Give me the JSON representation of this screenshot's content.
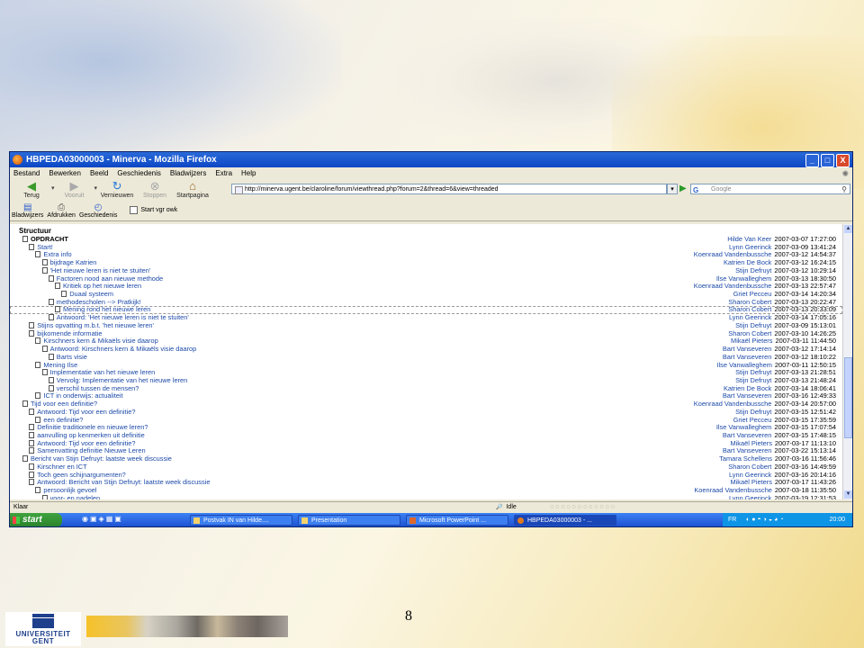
{
  "window": {
    "title": "HBPEDA03000003 - Minerva - Mozilla Firefox",
    "buttons": [
      "_",
      "□",
      "X"
    ]
  },
  "menu": [
    "Bestand",
    "Bewerken",
    "Beeld",
    "Geschiedenis",
    "Bladwijzers",
    "Extra",
    "Help"
  ],
  "nav": {
    "back": "Terug",
    "forward": "Vooruit",
    "reload": "Vernieuwen",
    "stop": "Stoppen",
    "home": "Startpagina",
    "url": "http://minerva.ugent.be/claroline/forum/viewthread.php?forum=2&thread=6&view=threaded",
    "search_placeholder": "Google"
  },
  "bookmarks": {
    "bladwijzers": "Bladwijzers",
    "afdrukken": "Afdrukken",
    "geschiedenis": "Geschiedenis",
    "autoscan": "Start vgr owk"
  },
  "structure_label": "Structuur",
  "threads": [
    {
      "title": "OPDRACHT",
      "author": "Hilde Van Keer",
      "date": "2007-03-07 17:27:00",
      "level": 0,
      "top": true
    },
    {
      "title": "Start!",
      "author": "Lynn Geerinck",
      "date": "2007-03-09 13:41:24",
      "level": 1
    },
    {
      "title": "Extra info",
      "author": "Koenraad Vandenbussche",
      "date": "2007-03-12 14:54:37",
      "level": 2
    },
    {
      "title": "bijdrage Katrien",
      "author": "Katrien De Bock",
      "date": "2007-03-12 16:24:15",
      "level": 3
    },
    {
      "title": "'Het nieuwe leren is niet te stuiten'",
      "author": "Stijn Defruyt",
      "date": "2007-03-12 10:29:14",
      "level": 3
    },
    {
      "title": "Factoren nood aan nieuwe methode",
      "author": "Ilse Vanwalleghem",
      "date": "2007-03-13 18:30:50",
      "level": 4
    },
    {
      "title": "Kritiek op het nieuwe leren",
      "author": "Koenraad Vandenbussche",
      "date": "2007-03-13 22:57:47",
      "level": 5
    },
    {
      "title": "Duaal systeem",
      "author": "Griet Pecceu",
      "date": "2007-03-14 14:20:34",
      "level": 6
    },
    {
      "title": "methodescholen --> Pratkijk!",
      "author": "Sharon Cobert",
      "date": "2007-03-13 20:22:47",
      "level": 4
    },
    {
      "title": "Mening rond het nieuwe leren",
      "author": "Sharon Cobert",
      "date": "2007-03-13 20:33:09",
      "level": 5,
      "selected": true
    },
    {
      "title": "Antwoord: 'Het nieuwe leren is niet te stuiten'",
      "author": "Lynn Geerinck",
      "date": "2007-03-14 17:05:16",
      "level": 4
    },
    {
      "title": "Stijns opvatting m.b.t. 'het nieuwe leren'",
      "author": "Stijn Defruyt",
      "date": "2007-03-09 15:13:01",
      "level": 1
    },
    {
      "title": "bijkomende informatie",
      "author": "Sharon Cobert",
      "date": "2007-03-10 14:26:25",
      "level": 1
    },
    {
      "title": "Kirschners kern & Mikaëls visie daarop",
      "author": "Mikaël Pieters",
      "date": "2007-03-11 11:44:50",
      "level": 2
    },
    {
      "title": "Antwoord: Kirschners kern & Mikaëls visie daarop",
      "author": "Bart Vanseveren",
      "date": "2007-03-12 17:14:14",
      "level": 3
    },
    {
      "title": "Barts visie",
      "author": "Bart Vanseveren",
      "date": "2007-03-12 18:10:22",
      "level": 4
    },
    {
      "title": "Mening Ilse",
      "author": "Ilse Vanwalleghem",
      "date": "2007-03-11 12:50:15",
      "level": 2
    },
    {
      "title": "Implementatie van het nieuwe leren",
      "author": "Stijn Defruyt",
      "date": "2007-03-13 21:28:51",
      "level": 3
    },
    {
      "title": "Vervolg: Implementatie van het nieuwe leren",
      "author": "Stijn Defruyt",
      "date": "2007-03-13 21:48:24",
      "level": 4
    },
    {
      "title": "verschil tussen de mensen?",
      "author": "Katrien De Bock",
      "date": "2007-03-14 18:06:41",
      "level": 4
    },
    {
      "title": "ICT in onderwijs: actualiteit",
      "author": "Bart Vanseveren",
      "date": "2007-03-16 12:49:33",
      "level": 2
    },
    {
      "title": "Tijd voor een definitie?",
      "author": "Koenraad Vandenbussche",
      "date": "2007-03-14 20:57:00",
      "level": 0
    },
    {
      "title": "Antwoord: Tijd voor een definitie?",
      "author": "Stijn Defruyt",
      "date": "2007-03-15 12:51:42",
      "level": 1
    },
    {
      "title": "een definitie?",
      "author": "Griet Pecceu",
      "date": "2007-03-15 17:35:59",
      "level": 2
    },
    {
      "title": "Definitie traditionele en nieuwe leren?",
      "author": "Ilse Vanwalleghem",
      "date": "2007-03-15 17:07:54",
      "level": 1
    },
    {
      "title": "aanvulling op kenmerken uit definitie",
      "author": "Bart Vanseveren",
      "date": "2007-03-15 17:48:15",
      "level": 1
    },
    {
      "title": "Antwoord: Tijd voor een definitie?",
      "author": "Mikaël Pieters",
      "date": "2007-03-17 11:13:10",
      "level": 1
    },
    {
      "title": "Samenvatting definitie Nieuwe Leren",
      "author": "Bart Vanseveren",
      "date": "2007-03-22 15:13:14",
      "level": 1
    },
    {
      "title": "Bericht van Stijn Defruyt: laatste week discussie",
      "author": "Tamara Schellens",
      "date": "2007-03-16 11:56:46",
      "level": 0
    },
    {
      "title": "Kirschner en ICT",
      "author": "Sharon Cobert",
      "date": "2007-03-16 14:49:59",
      "level": 1
    },
    {
      "title": "Toch geen schijnargumenten?",
      "author": "Lynn Geerinck",
      "date": "2007-03-16 20:14:16",
      "level": 1
    },
    {
      "title": "Antwoord: Bericht van Stijn Defruyt: laatste week discussie",
      "author": "Mikaël Pieters",
      "date": "2007-03-17 11:43:26",
      "level": 1
    },
    {
      "title": "persoonlijk gevoel",
      "author": "Koenraad Vandenbussche",
      "date": "2007-03-18 11:35:50",
      "level": 2
    },
    {
      "title": "voor- en nadelen",
      "author": "Lynn Geerinck",
      "date": "2007-03-19 12:31:53",
      "level": 3
    }
  ],
  "status": {
    "left": "Klaar",
    "idle": "Idle"
  },
  "taskbar": {
    "start": "start",
    "tasks": [
      "Postvak IN van Hilde....",
      "Presentation",
      "Microsoft PowerPoint ...",
      "HBPEDA03000003 - ..."
    ],
    "lang": "FR",
    "clock": "20:00"
  },
  "footer": {
    "logo_line1": "UNIVERSITEIT",
    "logo_line2": "GENT",
    "page_number": "8"
  }
}
